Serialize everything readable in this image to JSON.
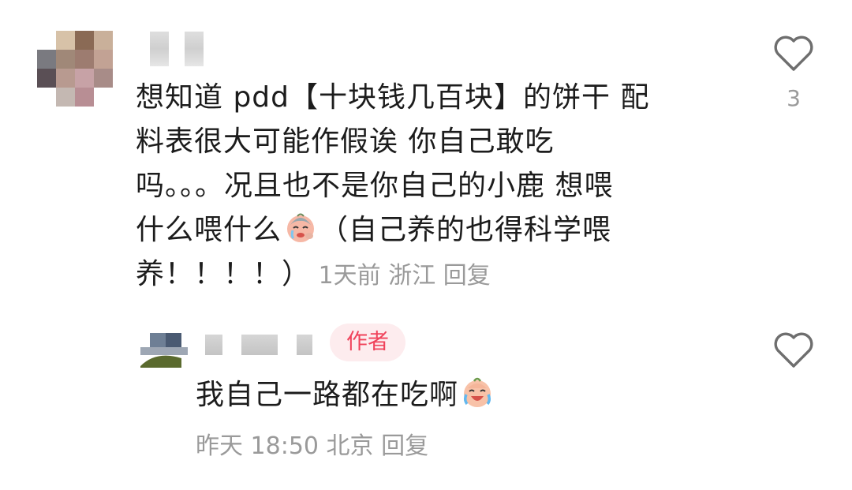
{
  "comment": {
    "lines": [
      "想知道 pdd【十块钱几百块】的饼干 配",
      "料表很大可能作假诶 你自己敢吃",
      "吗。。。况且也不是你自己的小鹿 想喂",
      "什么喂什么",
      "（自己养的也得科学喂",
      "养！！！！）"
    ],
    "time": "1天前",
    "location": "浙江",
    "reply_label": "回复",
    "like_count": "3",
    "emoji": "crying-face-emoji"
  },
  "reply": {
    "author_badge": "作者",
    "text": "我自己一路都在吃啊",
    "emoji": "laughing-crying-face-emoji",
    "time": "昨天 18:50",
    "location": "北京",
    "reply_label": "回复"
  },
  "colors": {
    "badge_bg": "#fdecee",
    "badge_text": "#f0435b",
    "meta_text": "#9a9a9a",
    "body_text": "#1c1c1c"
  }
}
